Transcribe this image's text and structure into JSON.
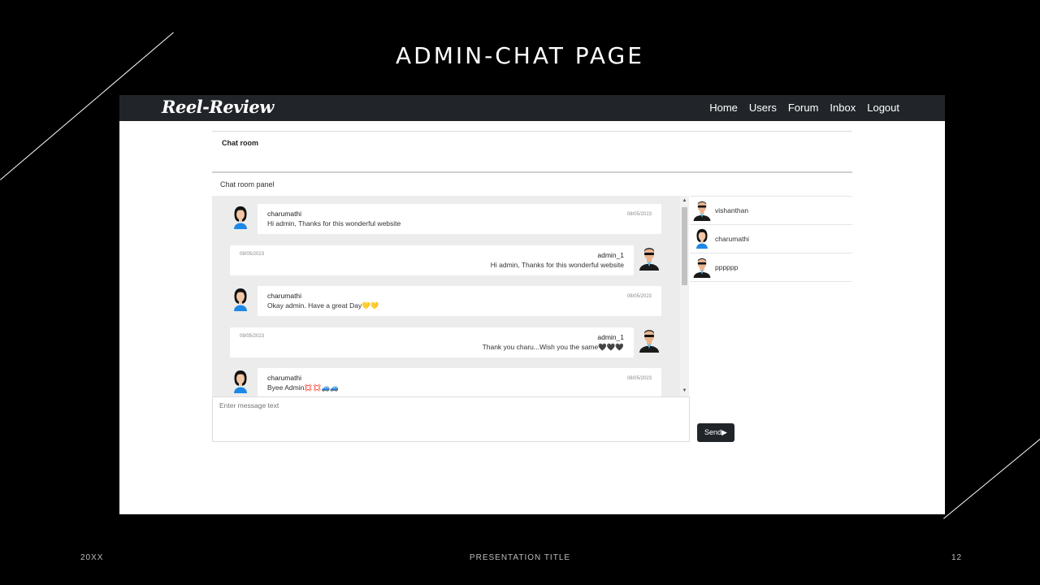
{
  "slide": {
    "title": "ADMIN-CHAT PAGE",
    "footer_left": "20XX",
    "footer_center": "PRESENTATION TITLE",
    "footer_right": "12"
  },
  "app": {
    "brand": "Reel-Review",
    "nav": [
      "Home",
      "Users",
      "Forum",
      "Inbox",
      "Logout"
    ],
    "chatroom_heading": "Chat room",
    "panel_label": "Chat room panel",
    "messages": [
      {
        "sender": "charumathi",
        "date": "08/05/2023",
        "text": "Hi admin, Thanks for this wonderful website",
        "side": "left",
        "avatar": "female-avatar-icon"
      },
      {
        "sender": "admin_1",
        "date": "08/05/2023",
        "text": "Hi admin, Thanks for this wonderful website",
        "side": "right",
        "avatar": "male-avatar-icon"
      },
      {
        "sender": "charumathi",
        "date": "08/05/2023",
        "text": "Okay admin. Have a great Day💛💛",
        "side": "left",
        "avatar": "female-avatar-icon"
      },
      {
        "sender": "admin_1",
        "date": "08/05/2023",
        "text": "Thank you charu...Wish you the same🖤🖤🖤",
        "side": "right",
        "avatar": "male-avatar-icon"
      },
      {
        "sender": "charumathi",
        "date": "08/05/2023",
        "text": "Byee Admin💢💢🚙🚙",
        "side": "left",
        "avatar": "female-avatar-icon"
      }
    ],
    "message_placeholder": "Enter message text",
    "send_label": "Send▶",
    "users": [
      {
        "name": "vishanthan",
        "avatar": "male-avatar-icon"
      },
      {
        "name": "charumathi",
        "avatar": "female-avatar-icon"
      },
      {
        "name": "pppppp",
        "avatar": "male-avatar-icon"
      }
    ]
  },
  "colors": {
    "navbar": "#212529",
    "chat_bg": "#ececec",
    "avatar_shirt_female": "#1e88e5",
    "avatar_shirt_male": "#1a1a1a"
  }
}
